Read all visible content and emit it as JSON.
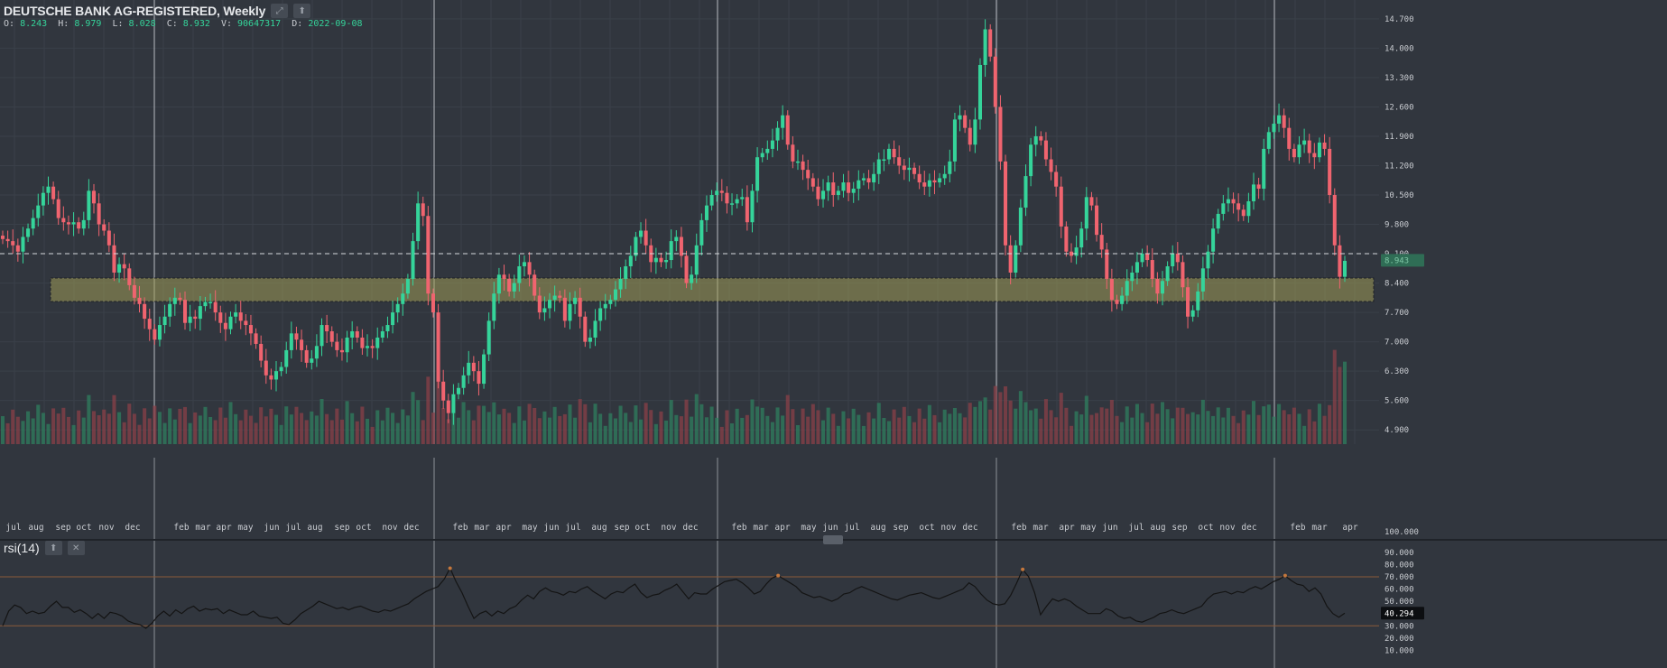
{
  "header": {
    "title": "DEUTSCHE BANK AG-REGISTERED, Weekly",
    "expand_icon": "expand-arrows-icon",
    "up_icon": "arrow-up-icon",
    "ohlc": {
      "o_label": "O:",
      "o": "8.243",
      "h_label": "H:",
      "h": "8.979",
      "l_label": "L:",
      "l": "8.028",
      "c_label": "C:",
      "c": "8.932",
      "v_label": "V:",
      "v": "90647317",
      "d_label": "D:",
      "d": "2022-09-08"
    }
  },
  "rsi_header": {
    "label": "rsi(14)",
    "up_icon": "arrow-up-icon",
    "close_icon": "close-icon"
  },
  "colors": {
    "background": "#31363e",
    "up": "#35d49a",
    "down": "#f0646f",
    "zone": "#9f9b56",
    "grid": "#3a4049",
    "rsi_line": "#141414",
    "rsi_band": "#8a5a3a"
  },
  "chart_data": {
    "type": "candlestick",
    "title": "DEUTSCHE BANK AG-REGISTERED, Weekly",
    "price_axis": {
      "ticks": [
        "14.700",
        "14.000",
        "13.300",
        "12.600",
        "11.900",
        "11.200",
        "10.500",
        "9.800",
        "9.100",
        "8.400",
        "7.700",
        "7.000",
        "6.300",
        "5.600",
        "4.900"
      ],
      "ylim": [
        4.56,
        15.02
      ]
    },
    "current_price_label": "8.943",
    "dashed_level": 9.1,
    "support_zone": {
      "low": 7.96,
      "high": 8.52
    },
    "time_axis": [
      "jul",
      "aug",
      "sep",
      "oct",
      "nov",
      "dec",
      "feb",
      "mar",
      "apr",
      "may",
      "jun",
      "jul",
      "aug",
      "sep",
      "oct",
      "nov",
      "dec",
      "feb",
      "mar",
      "apr",
      "may",
      "jun",
      "jul",
      "aug",
      "sep",
      "oct",
      "nov",
      "dec",
      "feb",
      "mar",
      "apr",
      "may",
      "jun",
      "jul",
      "aug",
      "sep",
      "oct",
      "nov",
      "dec",
      "feb",
      "mar",
      "apr",
      "may",
      "jun",
      "jul",
      "aug",
      "sep",
      "oct",
      "nov",
      "dec",
      "feb",
      "mar",
      "apr"
    ],
    "closes": [
      9.45,
      9.4,
      9.3,
      9.15,
      9.5,
      9.7,
      9.95,
      10.25,
      10.55,
      10.7,
      10.4,
      9.95,
      9.85,
      9.8,
      9.85,
      9.7,
      9.9,
      10.6,
      10.3,
      9.8,
      9.65,
      9.3,
      8.65,
      8.85,
      8.75,
      8.35,
      8.05,
      7.9,
      7.55,
      7.3,
      7.05,
      7.4,
      7.6,
      7.9,
      8.05,
      8.0,
      7.45,
      7.6,
      7.55,
      7.85,
      7.95,
      7.95,
      7.7,
      7.45,
      7.3,
      7.6,
      7.7,
      7.5,
      7.4,
      7.2,
      6.95,
      6.55,
      6.2,
      6.1,
      6.3,
      6.4,
      6.8,
      7.2,
      7.05,
      6.8,
      6.5,
      6.6,
      6.9,
      7.4,
      7.25,
      7.0,
      6.8,
      6.75,
      7.1,
      7.25,
      7.1,
      6.85,
      6.9,
      6.85,
      7.1,
      7.25,
      7.4,
      7.7,
      7.9,
      8.15,
      8.5,
      9.4,
      10.3,
      10.0,
      8.15,
      7.7,
      6.05,
      5.6,
      5.3,
      5.75,
      5.9,
      6.2,
      6.5,
      6.3,
      6.0,
      6.7,
      7.5,
      8.15,
      8.6,
      8.5,
      8.2,
      8.4,
      8.8,
      8.9,
      8.6,
      8.1,
      7.7,
      7.8,
      8.0,
      8.1,
      8.05,
      7.5,
      7.9,
      8.05,
      7.6,
      7.0,
      7.1,
      7.5,
      7.8,
      7.9,
      8.0,
      8.25,
      8.5,
      8.8,
      9.05,
      9.5,
      9.65,
      9.3,
      8.9,
      9.0,
      8.9,
      8.95,
      9.4,
      9.5,
      9.05,
      8.4,
      8.6,
      9.3,
      9.9,
      10.25,
      10.5,
      10.6,
      10.55,
      10.3,
      10.3,
      10.4,
      10.45,
      9.85,
      10.6,
      11.4,
      11.5,
      11.6,
      11.8,
      12.1,
      12.4,
      11.7,
      11.3,
      11.3,
      11.1,
      10.9,
      10.7,
      10.4,
      10.6,
      10.8,
      10.5,
      10.6,
      10.8,
      10.55,
      10.65,
      10.85,
      10.9,
      10.8,
      11.0,
      11.35,
      11.35,
      11.6,
      11.4,
      11.2,
      11.1,
      11.15,
      11.0,
      10.8,
      10.7,
      10.85,
      10.8,
      10.9,
      11.0,
      11.3,
      12.3,
      12.4,
      12.1,
      11.7,
      12.3,
      13.6,
      14.45,
      13.8,
      12.6,
      11.3,
      9.3,
      8.65,
      9.3,
      10.2,
      10.95,
      11.7,
      11.9,
      11.8,
      11.35,
      11.05,
      10.7,
      9.75,
      9.15,
      9.05,
      9.25,
      9.7,
      10.45,
      10.25,
      9.55,
      9.2,
      8.5,
      8.0,
      7.9,
      8.1,
      8.45,
      8.65,
      8.9,
      9.1,
      8.95,
      8.5,
      8.15,
      8.45,
      8.8,
      9.1,
      8.9,
      8.3,
      7.6,
      7.75,
      8.2,
      8.75,
      9.15,
      9.7,
      10.05,
      10.3,
      10.4,
      10.3,
      10.15,
      10.0,
      10.35,
      10.75,
      10.65,
      11.6,
      12.0,
      12.2,
      12.4,
      12.1,
      11.6,
      11.4,
      11.7,
      11.8,
      11.5,
      11.4,
      11.75,
      11.6,
      10.5,
      9.3,
      8.55,
      8.93
    ],
    "rsi": {
      "label": "rsi(14)",
      "ticks": [
        "90.000",
        "80.000",
        "70.000",
        "60.000",
        "50.000",
        "40.000",
        "30.000",
        "20.000",
        "10.000"
      ],
      "ylim": [
        0,
        95
      ],
      "overbought": 70,
      "oversold": 30,
      "current_label": "40.294",
      "values": [
        30,
        42,
        47,
        45,
        40,
        42,
        40,
        41,
        46,
        50,
        45,
        45,
        41,
        43,
        40,
        36,
        40,
        36,
        41,
        40,
        38,
        34,
        32,
        31,
        28,
        32,
        38,
        42,
        38,
        43,
        40,
        44,
        46,
        42,
        44,
        43,
        44,
        40,
        43,
        41,
        39,
        39,
        42,
        38,
        37,
        36,
        37,
        32,
        31,
        35,
        40,
        43,
        46,
        50,
        48,
        46,
        44,
        45,
        43,
        45,
        46,
        44,
        42,
        41,
        43,
        42,
        44,
        46,
        48,
        52,
        55,
        58,
        60,
        62,
        68,
        77,
        66,
        57,
        46,
        36,
        40,
        42,
        38,
        42,
        40,
        44,
        46,
        51,
        55,
        52,
        58,
        61,
        58,
        57,
        55,
        58,
        57,
        60,
        62,
        58,
        55,
        52,
        56,
        58,
        57,
        61,
        64,
        57,
        53,
        55,
        56,
        59,
        61,
        64,
        58,
        52,
        57,
        56,
        56,
        60,
        63,
        66,
        67,
        68,
        65,
        61,
        56,
        58,
        64,
        69,
        71,
        68,
        65,
        62,
        57,
        55,
        53,
        54,
        52,
        50,
        52,
        56,
        57,
        60,
        62,
        60,
        58,
        56,
        54,
        52,
        51,
        53,
        55,
        56,
        57,
        55,
        53,
        52,
        54,
        56,
        58,
        60,
        65,
        62,
        56,
        51,
        48,
        47,
        48,
        55,
        65,
        76,
        70,
        57,
        39,
        46,
        52,
        50,
        52,
        50,
        46,
        43,
        40,
        40,
        40,
        44,
        42,
        38,
        36,
        37,
        34,
        33,
        35,
        37,
        40,
        41,
        43,
        41,
        40,
        42,
        44,
        46,
        52,
        56,
        57,
        58,
        56,
        58,
        57,
        60,
        62,
        60,
        63,
        66,
        68,
        71,
        67,
        64,
        63,
        58,
        61,
        56,
        46,
        40,
        37,
        40.3
      ]
    }
  }
}
